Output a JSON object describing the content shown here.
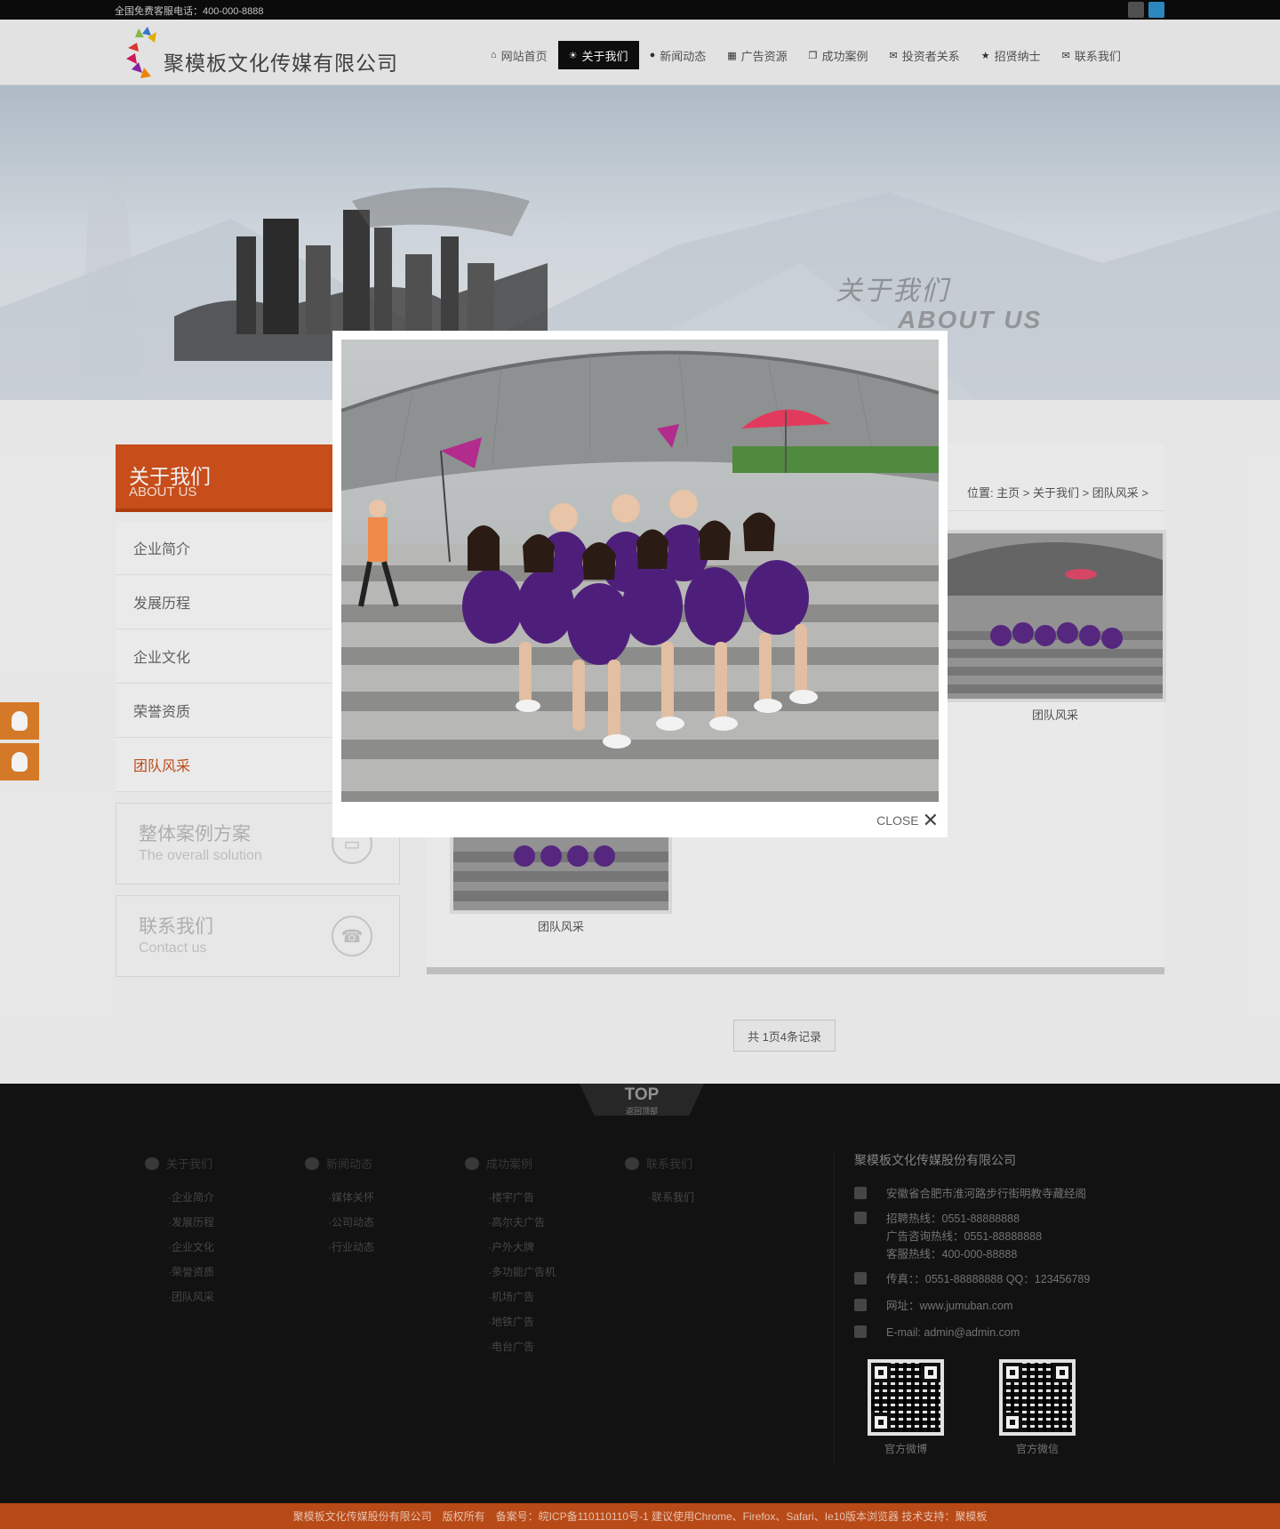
{
  "topbar": {
    "hotline": "全国免费客服电话：400-000-8888"
  },
  "header": {
    "company": "聚模板文化传媒有限公司",
    "nav": [
      {
        "label": "网站首页",
        "icon": "home-icon",
        "glyph": "⌂"
      },
      {
        "label": "关于我们",
        "icon": "sun-icon",
        "glyph": "☀"
      },
      {
        "label": "新闻动态",
        "icon": "user-icon",
        "glyph": "●"
      },
      {
        "label": "广告资源",
        "icon": "grid-icon",
        "glyph": "▦"
      },
      {
        "label": "成功案例",
        "icon": "copy-icon",
        "glyph": "❐"
      },
      {
        "label": "投资者关系",
        "icon": "chat-icon",
        "glyph": "✉"
      },
      {
        "label": "招贤纳士",
        "icon": "star-icon",
        "glyph": "★"
      },
      {
        "label": "联系我们",
        "icon": "mail-icon",
        "glyph": "✉"
      }
    ],
    "active_index": 1
  },
  "banner": {
    "title_cn": "关于我们",
    "title_en": "ABOUT US"
  },
  "sidebar": {
    "head_cn": "关于我们",
    "head_en": "ABOUT US",
    "items": [
      "企业简介",
      "发展历程",
      "企业文化",
      "荣誉资质",
      "团队风采"
    ],
    "active_index": 4,
    "solution": {
      "cn": "整体案例方案",
      "en": "The overall solution"
    },
    "contact": {
      "cn": "联系我们",
      "en": "Contact us"
    }
  },
  "main": {
    "breadcrumb": "位置: 主页 > 关于我们 > 团队风采 >",
    "thumbs": [
      "团队风采",
      "团队风采"
    ],
    "pager": "共 1页4条记录"
  },
  "lightbox": {
    "close_label": "CLOSE"
  },
  "footer": {
    "top_label": "TOP",
    "top_sub": "返回顶部",
    "columns": [
      {
        "title": "关于我们",
        "links": [
          "·企业简介",
          "·发展历程",
          "·企业文化",
          "·荣誉资质",
          "·团队风采"
        ]
      },
      {
        "title": "新闻动态",
        "links": [
          "·媒体关怀",
          "·公司动态",
          "·行业动态"
        ]
      },
      {
        "title": "成功案例",
        "links": [
          "·楼宇广告",
          "·高尔夫广告",
          "·户外大牌",
          "·多功能广告机",
          "·机场广告",
          "·地铁广告",
          "·电台广告"
        ]
      },
      {
        "title": "联系我们",
        "links": [
          "·联系我们"
        ]
      }
    ],
    "contact": {
      "title": "聚模板文化传媒股份有限公司",
      "address": "安徽省合肥市淮河路步行街明教寺藏经阁",
      "recruit": "招聘热线：0551-88888888",
      "ads": "广告咨询热线：0551-88888888",
      "service": "客服热线：400-000-88888",
      "fax": "传真：：0551-88888888 QQ：123456789",
      "site": "网址：www.jumuban.com",
      "email": "E-mail: admin@admin.com",
      "qr1": "官方微博",
      "qr2": "官方微信"
    },
    "copyright": "聚模板文化传媒股份有限公司　版权所有　备案号：皖ICP备110110110号-1 建议使用Chrome、Firefox、Safari、Ie10版本浏览器 技术支持：聚模板"
  }
}
